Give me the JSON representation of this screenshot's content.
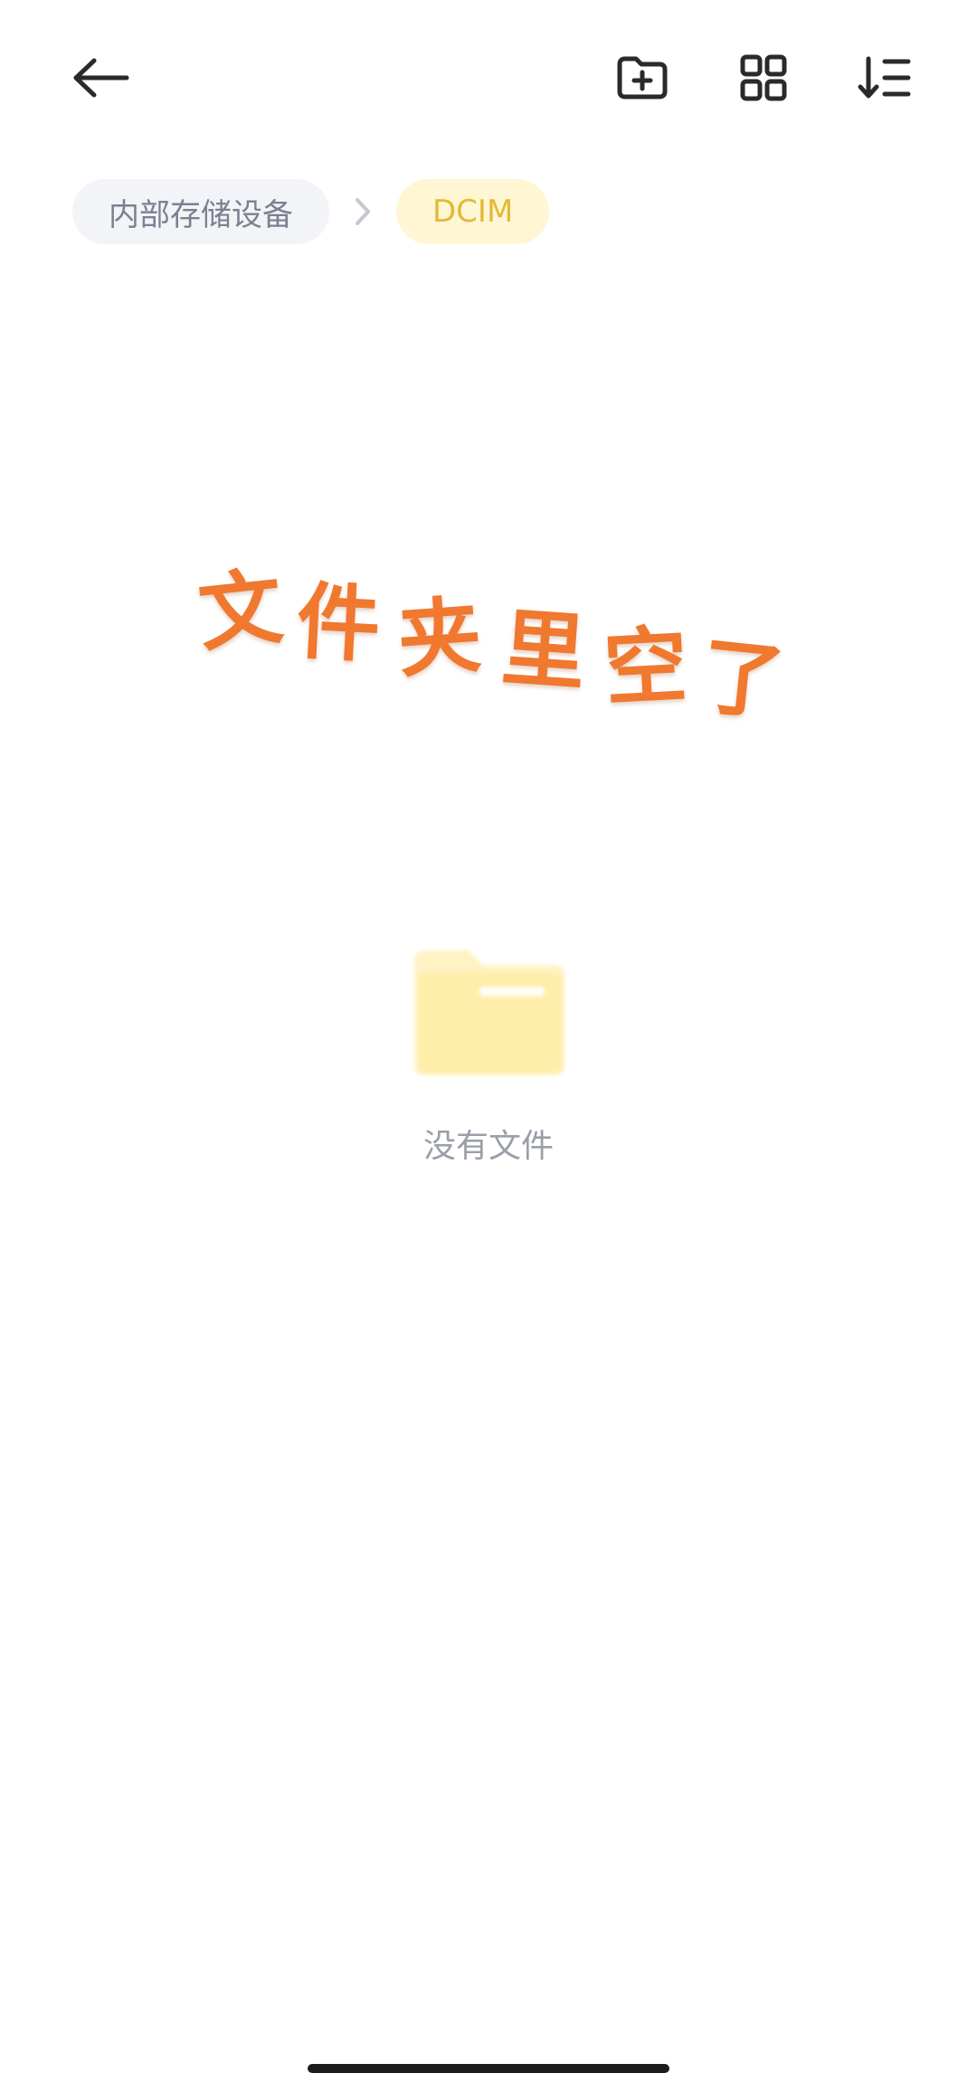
{
  "toolbar": {
    "back_icon": "arrow-left-icon",
    "new_folder_icon": "folder-plus-icon",
    "view_icon": "grid-icon",
    "sort_icon": "sort-icon"
  },
  "breadcrumb": {
    "root_label": "内部存储设备",
    "current_label": "DCIM"
  },
  "empty_state": {
    "banner_text": "文件夹里空了",
    "label": "没有文件"
  },
  "colors": {
    "accent_yellow": "#e4b937",
    "banner_orange": "#f0782f",
    "folder_yellow": "#fff0b0"
  }
}
